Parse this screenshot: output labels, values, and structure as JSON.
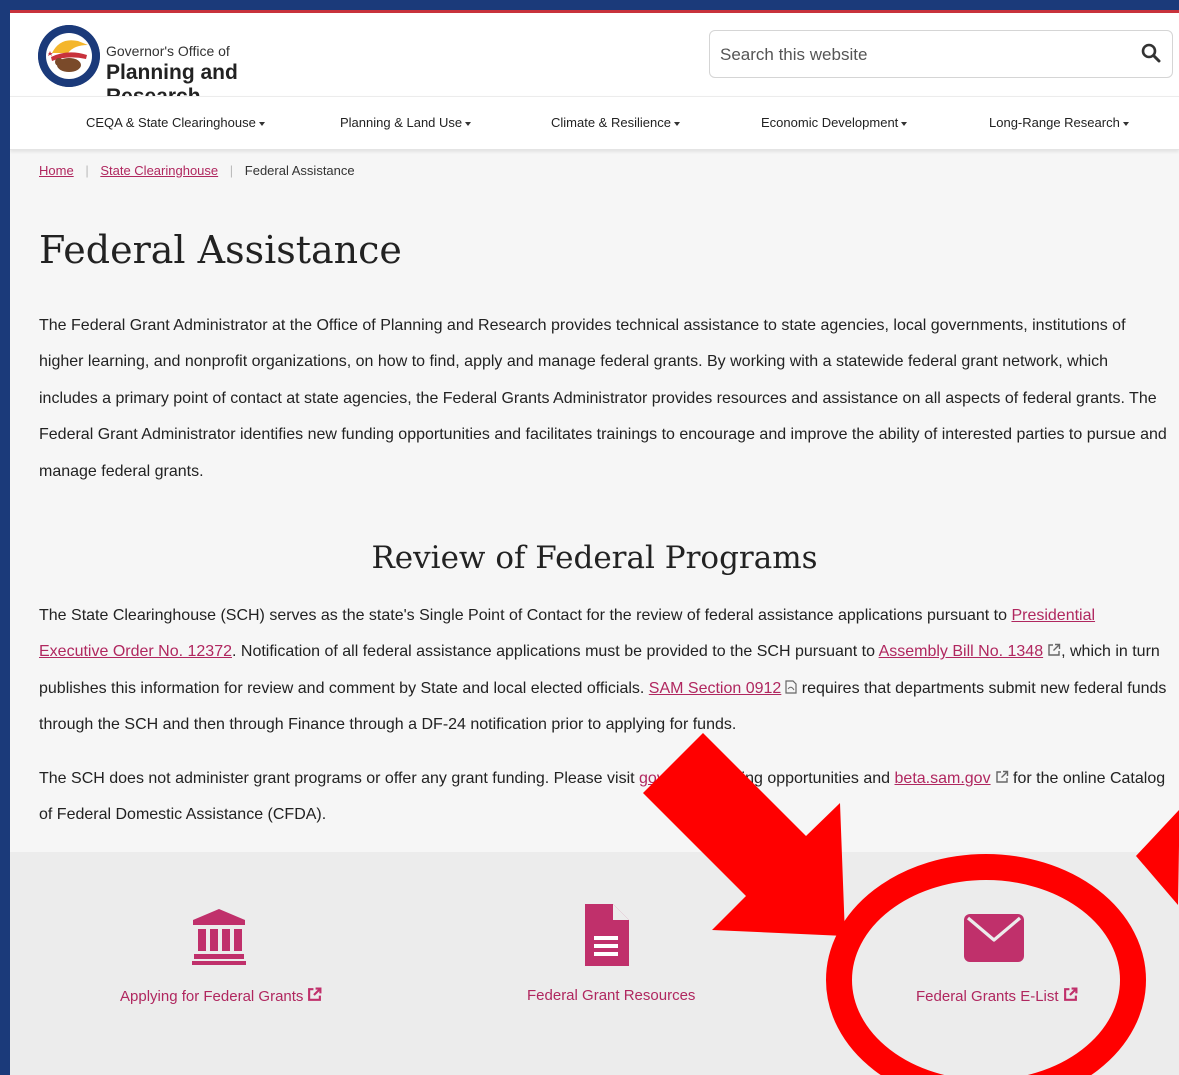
{
  "header": {
    "logo_small": "Governor's Office of",
    "logo_title": "Planning and Research",
    "search_placeholder": "Search this website"
  },
  "nav": {
    "items": [
      {
        "label": "CEQA & State Clearinghouse"
      },
      {
        "label": "Planning & Land Use"
      },
      {
        "label": "Climate & Resilience"
      },
      {
        "label": "Economic Development"
      },
      {
        "label": "Long-Range Research"
      }
    ]
  },
  "breadcrumb": {
    "home": "Home",
    "parent": "State Clearinghouse",
    "current": "Federal Assistance",
    "separator": "|"
  },
  "page": {
    "title": "Federal Assistance",
    "intro": "The Federal Grant Administrator at the Office of Planning and Research provides technical assistance to state agencies, local governments, institutions of higher learning, and nonprofit organizations, on how to find, apply and manage federal grants. By working with a statewide federal grant network, which includes a primary point of contact at state agencies, the Federal Grants Administrator provides resources and assistance on all aspects of federal grants. The Federal Grant Administrator identifies new funding opportunities and facilitates trainings to encourage and improve the ability of interested parties to pursue and manage federal grants.",
    "section_title": "Review of Federal Programs",
    "p2": {
      "t1": "The State Clearinghouse (SCH) serves as the state's Single Point of Contact for the review of federal assistance applications pursuant to ",
      "link1": "Presidential Executive Order No. 12372",
      "t2": ". Notification of all federal assistance applications must be provided to the SCH pursuant to ",
      "link2": "Assembly Bill No. 1348",
      "t3": ", which in turn publishes this information for review and comment by State and local elected officials. ",
      "link3": "SAM Section 0912",
      "t4": " requires that departments submit new federal funds through the SCH and then through Finance through a DF-24 notification prior to applying for funds."
    },
    "p3": {
      "t1": "The SCH does not administer grant programs or offer any grant funding. Please visit ",
      "link1": "gov",
      "t2": " for funding opportunities and ",
      "link2": "beta.sam.gov",
      "t3": " for the online Catalog of Federal Domestic Assistance (CFDA)."
    }
  },
  "cards": [
    {
      "label": "Applying for Federal Grants",
      "icon": "bank-icon"
    },
    {
      "label": "Federal Grant Resources",
      "icon": "document-icon"
    },
    {
      "label": "Federal Grants E-List",
      "icon": "envelope-icon"
    }
  ],
  "colors": {
    "accent": "#b0275f",
    "icon": "#c0306b",
    "frame": "#1b3a7a",
    "annotation": "#ff0000"
  }
}
